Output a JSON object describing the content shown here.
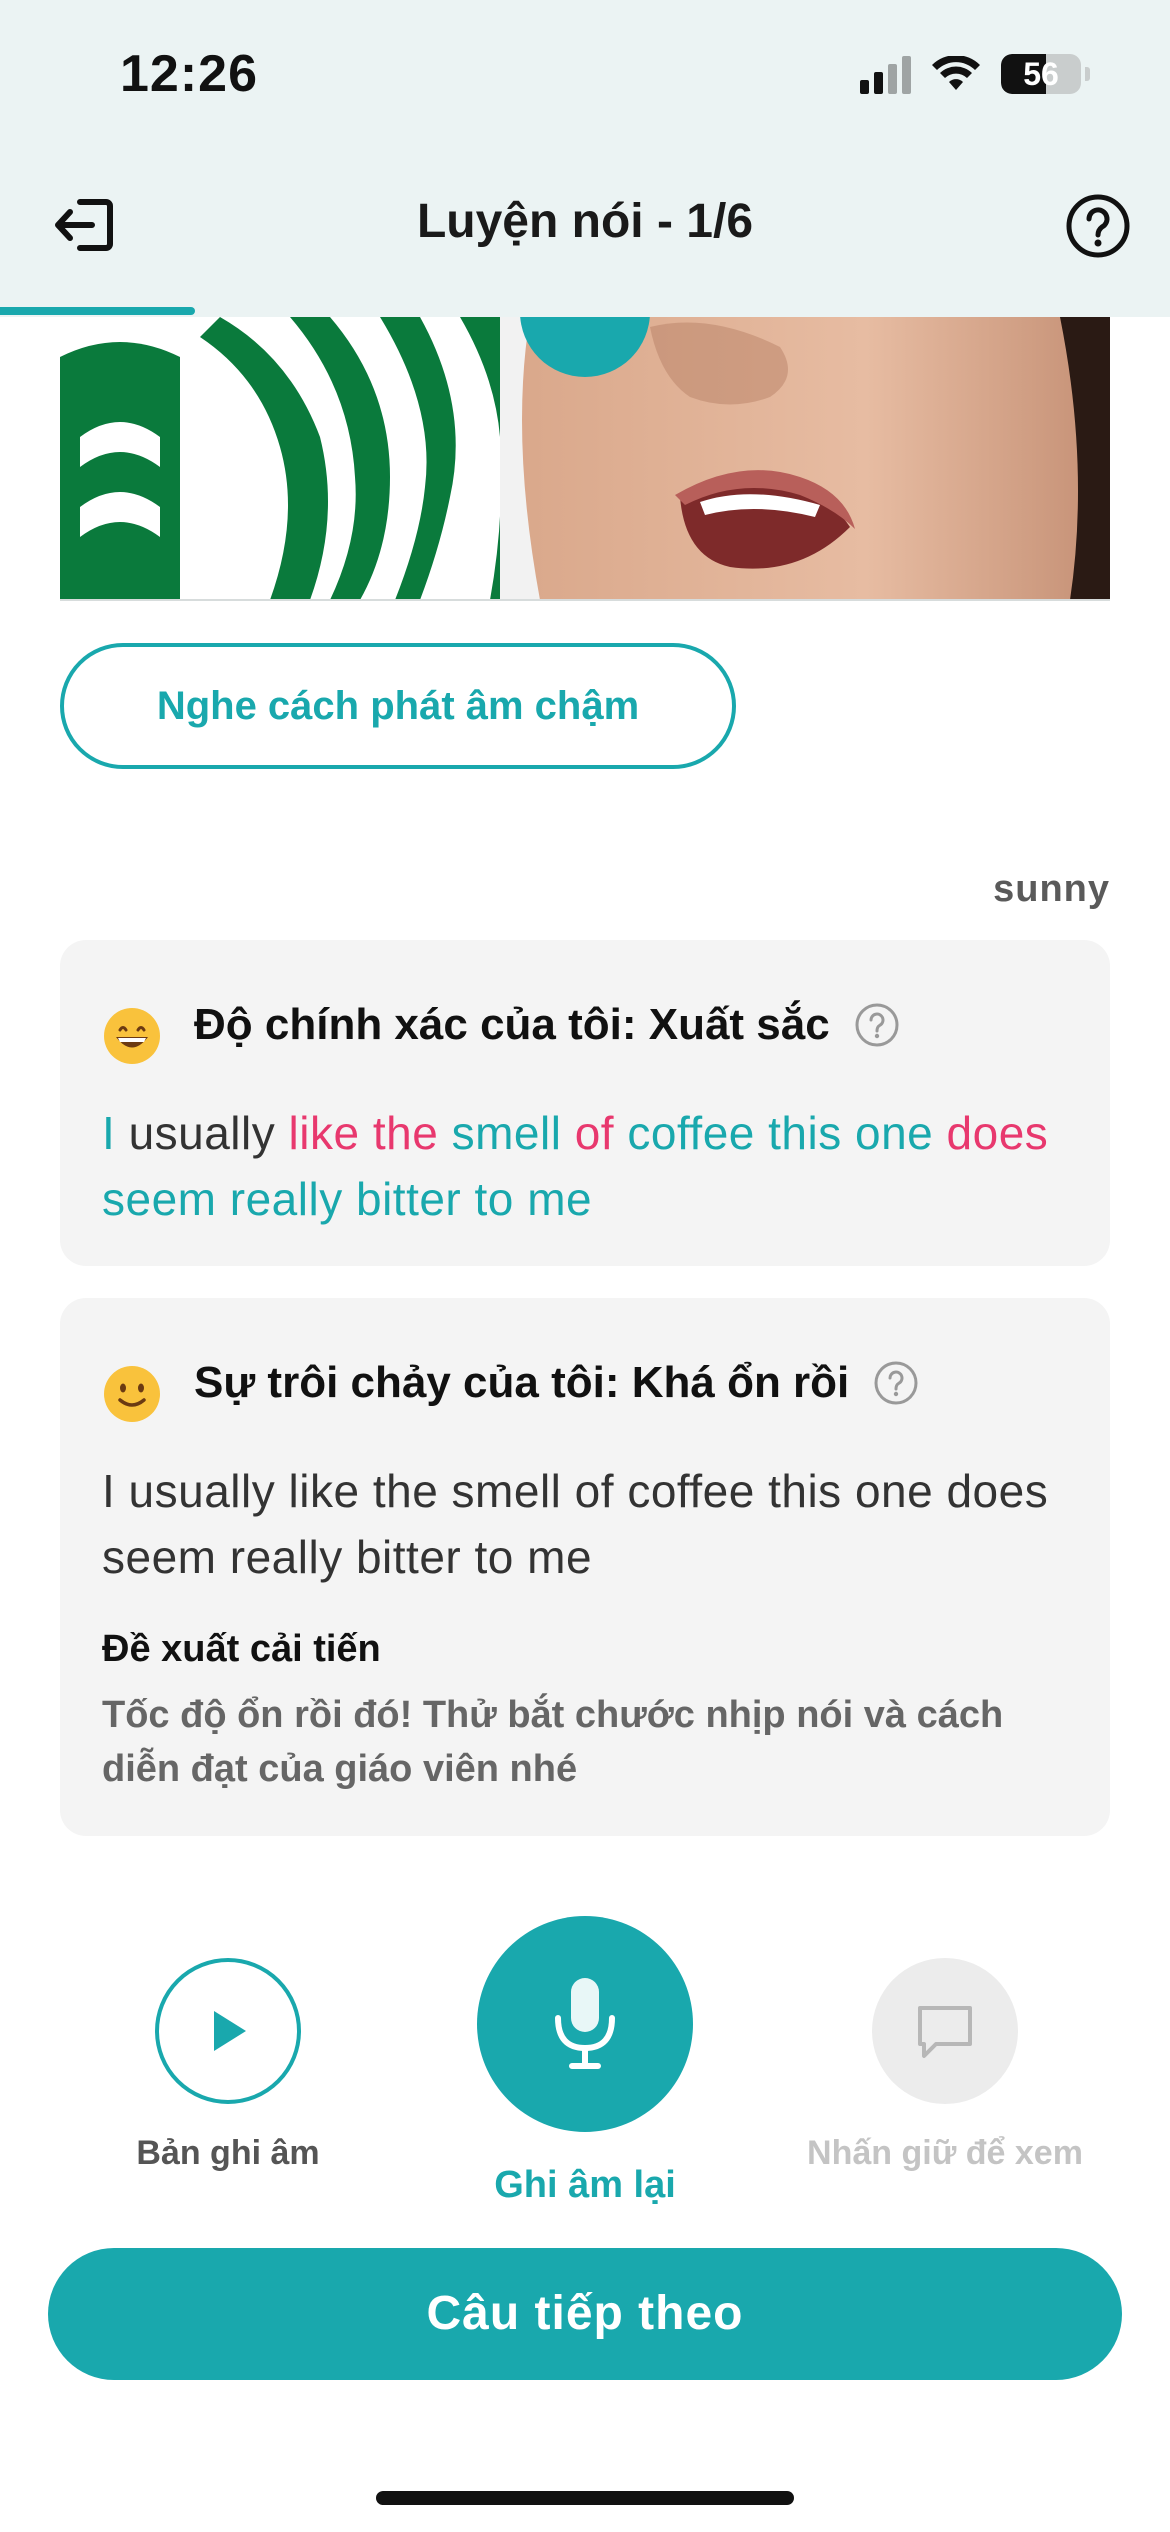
{
  "status_bar": {
    "time": "12:26",
    "battery": "56",
    "battery_level": 0.56,
    "icons": [
      "cellular-signal-icon",
      "wifi-icon",
      "battery-icon"
    ]
  },
  "header": {
    "title": "Luyện nói  - 1/6",
    "progress": 0.1667,
    "left_icon": "exit-icon",
    "right_icon": "help-icon"
  },
  "slow_button_label": "Nghe cách phát âm chậm",
  "username": "sunny",
  "accuracy_card": {
    "title": "Độ chính xác của tôi: Xuất sắc",
    "emoji": "grinning-face-icon",
    "words": [
      {
        "text": "I",
        "status": "good"
      },
      {
        "text": "usually",
        "status": "plain"
      },
      {
        "text": "like",
        "status": "bad"
      },
      {
        "text": "the",
        "status": "bad"
      },
      {
        "text": "smell",
        "status": "good"
      },
      {
        "text": "of",
        "status": "bad"
      },
      {
        "text": "coffee",
        "status": "good"
      },
      {
        "text": "this",
        "status": "good"
      },
      {
        "text": "one",
        "status": "good"
      },
      {
        "text": "does",
        "status": "bad"
      },
      {
        "text": "seem",
        "status": "good"
      },
      {
        "text": "really",
        "status": "good"
      },
      {
        "text": "bitter",
        "status": "good"
      },
      {
        "text": "to",
        "status": "good"
      },
      {
        "text": "me",
        "status": "good"
      }
    ]
  },
  "fluency_card": {
    "title": "Sự trôi chảy của tôi: Khá ổn rồi",
    "emoji": "slightly-smiling-face-icon",
    "sentence": "I usually like the smell of coffee this one does seem really bitter to me",
    "suggestion_title": "Đề xuất cải tiến",
    "suggestion_body": "Tốc độ ổn rồi đó! Thử bắt chước nhịp nói và cách diễn đạt của giáo viên nhé"
  },
  "controls": {
    "recording_label": "Bản ghi âm",
    "rerecord_label": "Ghi âm lại",
    "hold_label": "Nhấn giữ để xem"
  },
  "next_button_label": "Câu tiếp theo",
  "colors": {
    "accent": "#19a8ad",
    "error": "#e8386e",
    "header_bg": "#ebf3f3",
    "card_bg": "#f4f4f4"
  }
}
